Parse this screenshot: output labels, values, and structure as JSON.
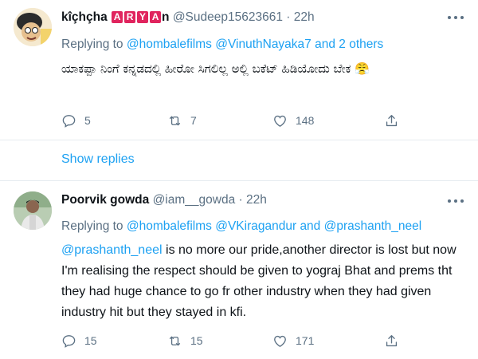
{
  "tweets": [
    {
      "name_prefix": "kîçhçha ",
      "badges": [
        "A",
        "R",
        "Y",
        "A"
      ],
      "name_suffix": "n",
      "handle": "@Sudeep15623661",
      "dot": "·",
      "time": "22h",
      "replying_to_label": "Replying to",
      "replying_links": [
        "@hombalefilms",
        "@VinuthNayaka7",
        "and 2 others"
      ],
      "text": "ಯಾಕಪ್ಪಾ ನಿಂಗೆ ಕನ್ನಡದಲ್ಲಿ ಹೀರೋ ಸಿಗಲಿಲ್ಲ ಅಲ್ಲಿ ಬಕೆಟ್ ಹಿಡಿಯೋದು ಬೇಕ 😤",
      "actions": {
        "replies": "5",
        "retweets": "7",
        "likes": "148"
      }
    },
    {
      "name": "Poorvik gowda",
      "handle": "@iam__gowda",
      "dot": "·",
      "time": "22h",
      "replying_to_label": "Replying to",
      "replying_links": [
        "@hombalefilms",
        "@VKiragandur",
        "and",
        "@prashanth_neel"
      ],
      "text_mention": "@prashanth_neel",
      "text_rest": " is no more our pride,another director is lost but now I'm realising the respect should be given to yograj Bhat and prems tht they had huge chance to go fr other industry when they had given industry hit but they stayed in kfi.",
      "actions": {
        "replies": "15",
        "retweets": "15",
        "likes": "171"
      }
    }
  ],
  "show_replies": "Show replies",
  "colors": {
    "link": "#1da1f2",
    "muted": "#5b7083",
    "badge": "#e0245e"
  },
  "icons": [
    "reply-icon",
    "retweet-icon",
    "like-icon",
    "share-icon",
    "more-icon"
  ]
}
